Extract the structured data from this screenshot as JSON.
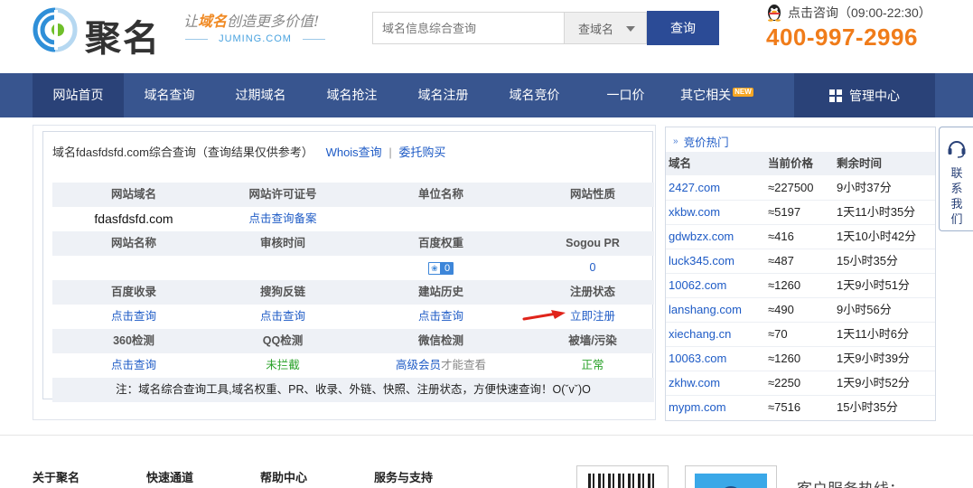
{
  "header": {
    "logo_text": "聚名",
    "slogan_pre": "让",
    "slogan_hl": "域名",
    "slogan_post": "创造更多价值!",
    "slogan_en": "JUMING.COM",
    "search_placeholder": "域名信息综合查询",
    "search_select": "查域名",
    "search_button": "查询",
    "consult_label": "点击咨询（09:00-22:30）",
    "hotline": "400-997-2996"
  },
  "nav": {
    "items": [
      {
        "label": "网站首页",
        "active": true
      },
      {
        "label": "域名查询"
      },
      {
        "label": "过期域名"
      },
      {
        "label": "域名抢注"
      },
      {
        "label": "域名注册"
      },
      {
        "label": "域名竞价"
      },
      {
        "label": "一口价"
      },
      {
        "label": "其它相关",
        "badge": "NEW"
      }
    ],
    "management": "管理中心"
  },
  "query": {
    "title": "域名fdasfdsfd.com综合查询（查询结果仅供参考）",
    "whois_link": "Whois查询",
    "sep": "|",
    "buy_link": "委托购买",
    "headers1": [
      "网站域名",
      "网站许可证号",
      "单位名称",
      "网站性质"
    ],
    "row1": {
      "domain": "fdasfdsfd.com",
      "icp": "点击查询备案",
      "org": "",
      "nature": ""
    },
    "headers2": [
      "网站名称",
      "审核时间",
      "百度权重",
      "Sogou PR"
    ],
    "row2": {
      "name": "",
      "audit": "",
      "baidu_weight": "0",
      "sogou_pr": "0"
    },
    "headers3": [
      "百度收录",
      "搜狗反链",
      "建站历史",
      "注册状态"
    ],
    "row3": {
      "baidu_index": "点击查询",
      "sogou_links": "点击查询",
      "history": "点击查询",
      "register": "立即注册"
    },
    "headers4": [
      "360检测",
      "QQ检测",
      "微信检测",
      "被墙/污染"
    ],
    "row4": {
      "check360": "点击查询",
      "qq": "未拦截",
      "wechat_link": "高级会员",
      "wechat_suffix": "才能查看",
      "blocked": "正常"
    },
    "note": "注：域名综合查询工具,域名权重、PR、收录、外链、快照、注册状态，方便快速查询！O(ˇvˇ)O"
  },
  "hot": {
    "title": "竞价热门",
    "headers": [
      "域名",
      "当前价格",
      "剩余时间"
    ],
    "rows": [
      {
        "domain": "2427.com",
        "price": "≈227500",
        "time": "9小时37分"
      },
      {
        "domain": "xkbw.com",
        "price": "≈5197",
        "time": "1天11小时35分"
      },
      {
        "domain": "gdwbzx.com",
        "price": "≈416",
        "time": "1天10小时42分"
      },
      {
        "domain": "luck345.com",
        "price": "≈487",
        "time": "15小时35分"
      },
      {
        "domain": "10062.com",
        "price": "≈1260",
        "time": "1天9小时51分"
      },
      {
        "domain": "lanshang.com",
        "price": "≈490",
        "time": "9小时56分"
      },
      {
        "domain": "xiechang.cn",
        "price": "≈70",
        "time": "1天11小时6分"
      },
      {
        "domain": "10063.com",
        "price": "≈1260",
        "time": "1天9小时39分"
      },
      {
        "domain": "zkhw.com",
        "price": "≈2250",
        "time": "1天9小时52分"
      },
      {
        "domain": "mypm.com",
        "price": "≈7516",
        "time": "15小时35分"
      }
    ]
  },
  "contact": {
    "label": "联系我们"
  },
  "footer": {
    "cols": [
      "关于聚名",
      "快速通道",
      "帮助中心",
      "服务与支持"
    ],
    "service_hotline": "客户服务热线："
  },
  "colors": {
    "nav": "#38558f",
    "nav_dark": "#2a4278",
    "hotline": "#f07c1a",
    "link": "#1e5bc6"
  }
}
